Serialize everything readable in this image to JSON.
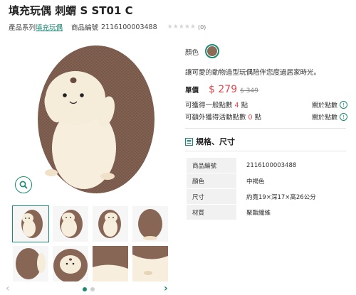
{
  "product": {
    "title": "填充玩偶 刺蝟 S ST01 C",
    "series_label": "產品系列",
    "series_link": "填充玩偶",
    "code_label": "商品編號",
    "code": "2116100003488",
    "stars": "★★★★★",
    "rating": 0,
    "review_count": "(0)"
  },
  "gallery": {
    "thumbnail_count": 8,
    "selected_index": 0,
    "page_dots": 2,
    "active_dot": 0,
    "prev_icon": "chevron-left-icon",
    "next_icon": "chevron-right-icon",
    "zoom_icon": "search-icon"
  },
  "options": {
    "color_label": "顏色",
    "color_swatch": "#8b6a56"
  },
  "description": "讓可愛的動物造型玩偶陪伴您度過居家時光。",
  "pricing": {
    "label": "單價",
    "price": "$ 279",
    "original_price": "$ 349"
  },
  "points": {
    "general_prefix": "可獲得一般點數",
    "general_value": "4",
    "general_suffix": "點",
    "general_link": "關於點數",
    "event_prefix": "可額外獲得活動點數",
    "event_value": "0",
    "event_suffix": "點",
    "event_link": "關於點數",
    "info_icon": "!"
  },
  "spec": {
    "heading": "規格、尺寸",
    "rows": [
      {
        "key": "商品編號",
        "value": "2116100003488"
      },
      {
        "key": "顏色",
        "value": "中褐色"
      },
      {
        "key": "尺寸",
        "value": "約寬19×深17×高26公分"
      },
      {
        "key": "材質",
        "value": "聚酯纖維"
      }
    ]
  },
  "colors": {
    "accent": "#1a8a74",
    "price_red": "#e8464d"
  }
}
